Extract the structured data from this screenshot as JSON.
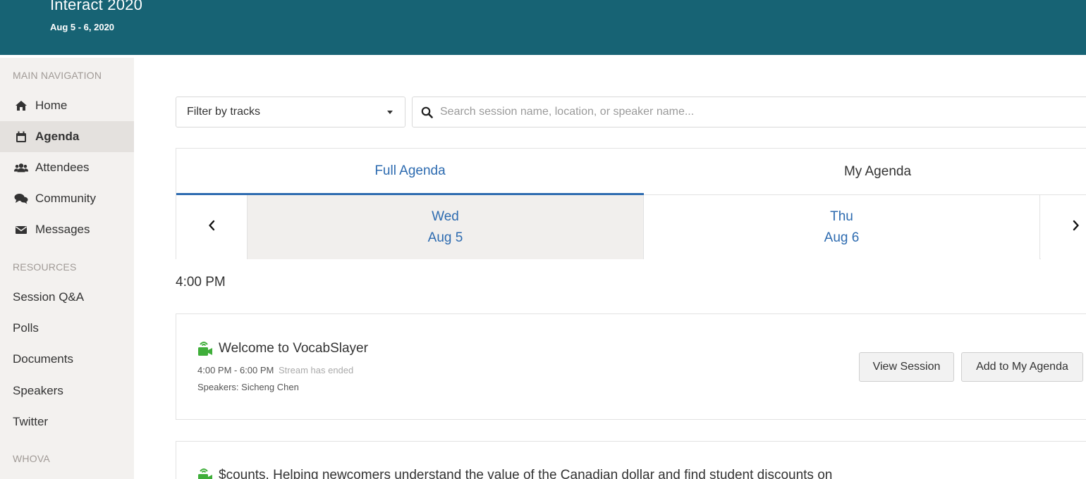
{
  "header": {
    "title": "Interact 2020",
    "dates": "Aug 5 - 6, 2020",
    "background": "#176374"
  },
  "sidebar": {
    "main_label": "MAIN NAVIGATION",
    "nav": [
      {
        "label": "Home",
        "icon": "home-icon"
      },
      {
        "label": "Agenda",
        "icon": "calendar-icon",
        "active": true
      },
      {
        "label": "Attendees",
        "icon": "users-icon"
      },
      {
        "label": "Community",
        "icon": "comments-icon"
      },
      {
        "label": "Messages",
        "icon": "envelope-icon"
      }
    ],
    "resources_label": "RESOURCES",
    "resources": [
      {
        "label": "Session Q&A"
      },
      {
        "label": "Polls"
      },
      {
        "label": "Documents"
      },
      {
        "label": "Speakers"
      },
      {
        "label": "Twitter"
      }
    ],
    "whova_label": "WHOVA"
  },
  "filter": {
    "label": "Filter by tracks"
  },
  "search": {
    "placeholder": "Search session name, location, or speaker name..."
  },
  "tabs": {
    "full": "Full Agenda",
    "mine": "My Agenda",
    "accent": "#2d6bb0"
  },
  "days": [
    {
      "weekday": "Wed",
      "date": "Aug 5",
      "selected": true
    },
    {
      "weekday": "Thu",
      "date": "Aug 6",
      "selected": false
    }
  ],
  "time_slot": "4:00 PM",
  "sessions": [
    {
      "title": "Welcome to VocabSlayer",
      "time": "4:00 PM - 6:00 PM",
      "status": "Stream has ended",
      "speakers": "Speakers: Sicheng Chen",
      "view_label": "View Session",
      "add_label": "Add to My Agenda",
      "icon_color": "#3fae3a"
    },
    {
      "title": "$counts. Helping newcomers understand the value of the Canadian dollar and find student discounts on"
    }
  ]
}
